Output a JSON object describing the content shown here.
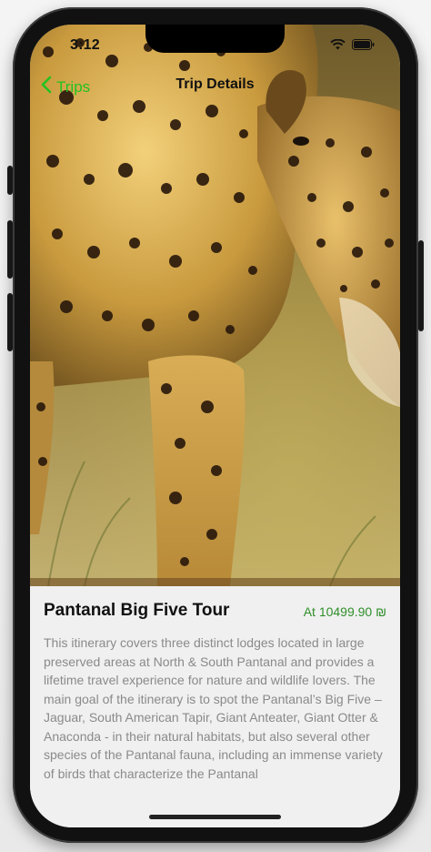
{
  "status_bar": {
    "time": "3:12",
    "icons": [
      "wifi-icon",
      "battery-icon"
    ]
  },
  "nav": {
    "back_label": "Trips",
    "title": "Trip Details",
    "accent_color": "#23c21f"
  },
  "hero": {
    "subject": "jaguar-photo"
  },
  "trip": {
    "title": "Pantanal Big Five Tour",
    "price": "At 10499.90 ₪",
    "description": "This itinerary covers three distinct lodges located in large preserved areas at North & South Pantanal and provides a lifetime travel experience for nature and wildlife lovers. The main goal of the itinerary is to spot the Pantanal’s Big Five – Jaguar, South American Tapir, Giant Anteater, Giant Otter & Anaconda - in their natural habitats, but also several other species of the Pantanal fauna, including an immense variety of birds that characterize the Pantanal"
  },
  "colors": {
    "price": "#2f8f2a",
    "description": "#8a8a8a"
  }
}
